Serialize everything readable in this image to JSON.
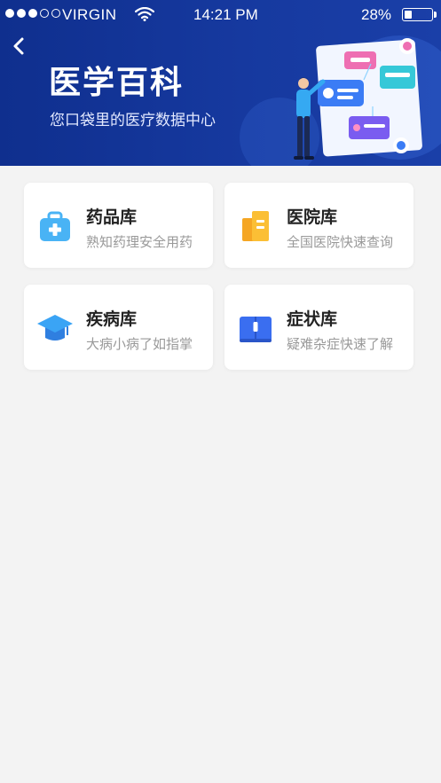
{
  "status_bar": {
    "carrier": "VIRGIN",
    "time": "14:21 PM",
    "battery": "28%",
    "battery_level": 0.28
  },
  "header": {
    "back_icon": "chevron-left-icon",
    "title": "医学百科",
    "subtitle": "您口袋里的医疗数据中心"
  },
  "categories": [
    {
      "title": "药品库",
      "subtitle": "熟知药理安全用药",
      "icon": "medicine-kit-icon",
      "color": "#49b3f5"
    },
    {
      "title": "医院库",
      "subtitle": "全国医院快速查询",
      "icon": "hospital-building-icon",
      "color": "#f5a623"
    },
    {
      "title": "疾病库",
      "subtitle": "大病小病了如指掌",
      "icon": "graduation-cap-icon",
      "color": "#2f9cf0"
    },
    {
      "title": "症状库",
      "subtitle": "疑难杂症快速了解",
      "icon": "book-icon",
      "color": "#3a6ef0"
    }
  ]
}
